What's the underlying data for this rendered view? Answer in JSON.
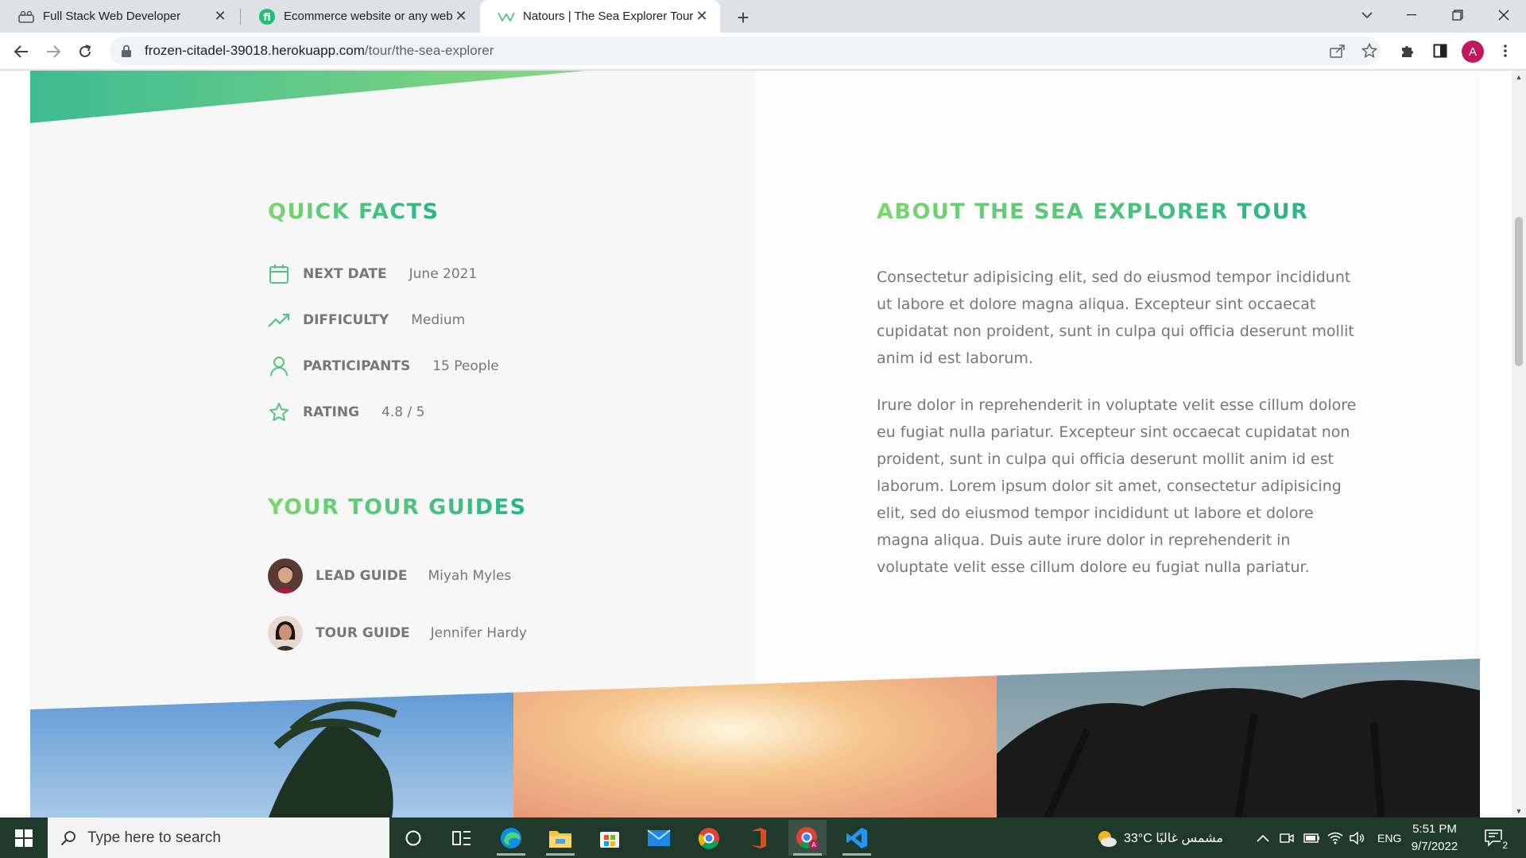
{
  "browser": {
    "tabs": [
      {
        "title": "Full Stack Web Developer",
        "favicon": "job-site-icon",
        "active": false
      },
      {
        "title": "Ecommerce website or any webs",
        "favicon": "fiverr-icon",
        "active": false
      },
      {
        "title": "Natours | The Sea Explorer Tour",
        "favicon": "natours-logo-icon",
        "active": true
      }
    ],
    "url_host": "frozen-citadel-39018.herokuapp.com",
    "url_path": "/tour/the-sea-explorer",
    "profile_initial": "A"
  },
  "page": {
    "quick_facts_title": "QUICK FACTS",
    "facts": [
      {
        "label": "NEXT DATE",
        "value": "June 2021",
        "icon": "calendar-icon"
      },
      {
        "label": "DIFFICULTY",
        "value": "Medium",
        "icon": "trending-up-icon"
      },
      {
        "label": "PARTICIPANTS",
        "value": "15 People",
        "icon": "user-icon"
      },
      {
        "label": "RATING",
        "value": "4.8 / 5",
        "icon": "star-icon"
      }
    ],
    "guides_title": "YOUR TOUR GUIDES",
    "guides": [
      {
        "role": "LEAD GUIDE",
        "name": "Miyah Myles"
      },
      {
        "role": "TOUR GUIDE",
        "name": "Jennifer Hardy"
      }
    ],
    "about_title": "ABOUT THE SEA EXPLORER TOUR",
    "paragraphs": [
      "Consectetur adipisicing elit, sed do eiusmod tempor incididunt ut labore et dolore magna aliqua. Excepteur sint occaecat cupidatat non proident, sunt in culpa qui officia deserunt mollit anim id est laborum.",
      "Irure dolor in reprehenderit in voluptate velit esse cillum dolore eu fugiat nulla pariatur. Excepteur sint occaecat cupidatat non proident, sunt in culpa qui officia deserunt mollit anim id est laborum. Lorem ipsum dolor sit amet, consectetur adipisicing elit, sed do eiusmod tempor incididunt ut labore et dolore magna aliqua. Duis aute irure dolor in reprehenderit in voluptate velit esse cillum dolore eu fugiat nulla pariatur."
    ],
    "brand_color": "#55c57a",
    "text_color": "#777777"
  },
  "taskbar": {
    "search_placeholder": "Type here to search",
    "weather": "33°C مشمس غالبًا",
    "language": "ENG",
    "time": "5:51 PM",
    "date": "9/7/2022",
    "notification_count": "2"
  }
}
